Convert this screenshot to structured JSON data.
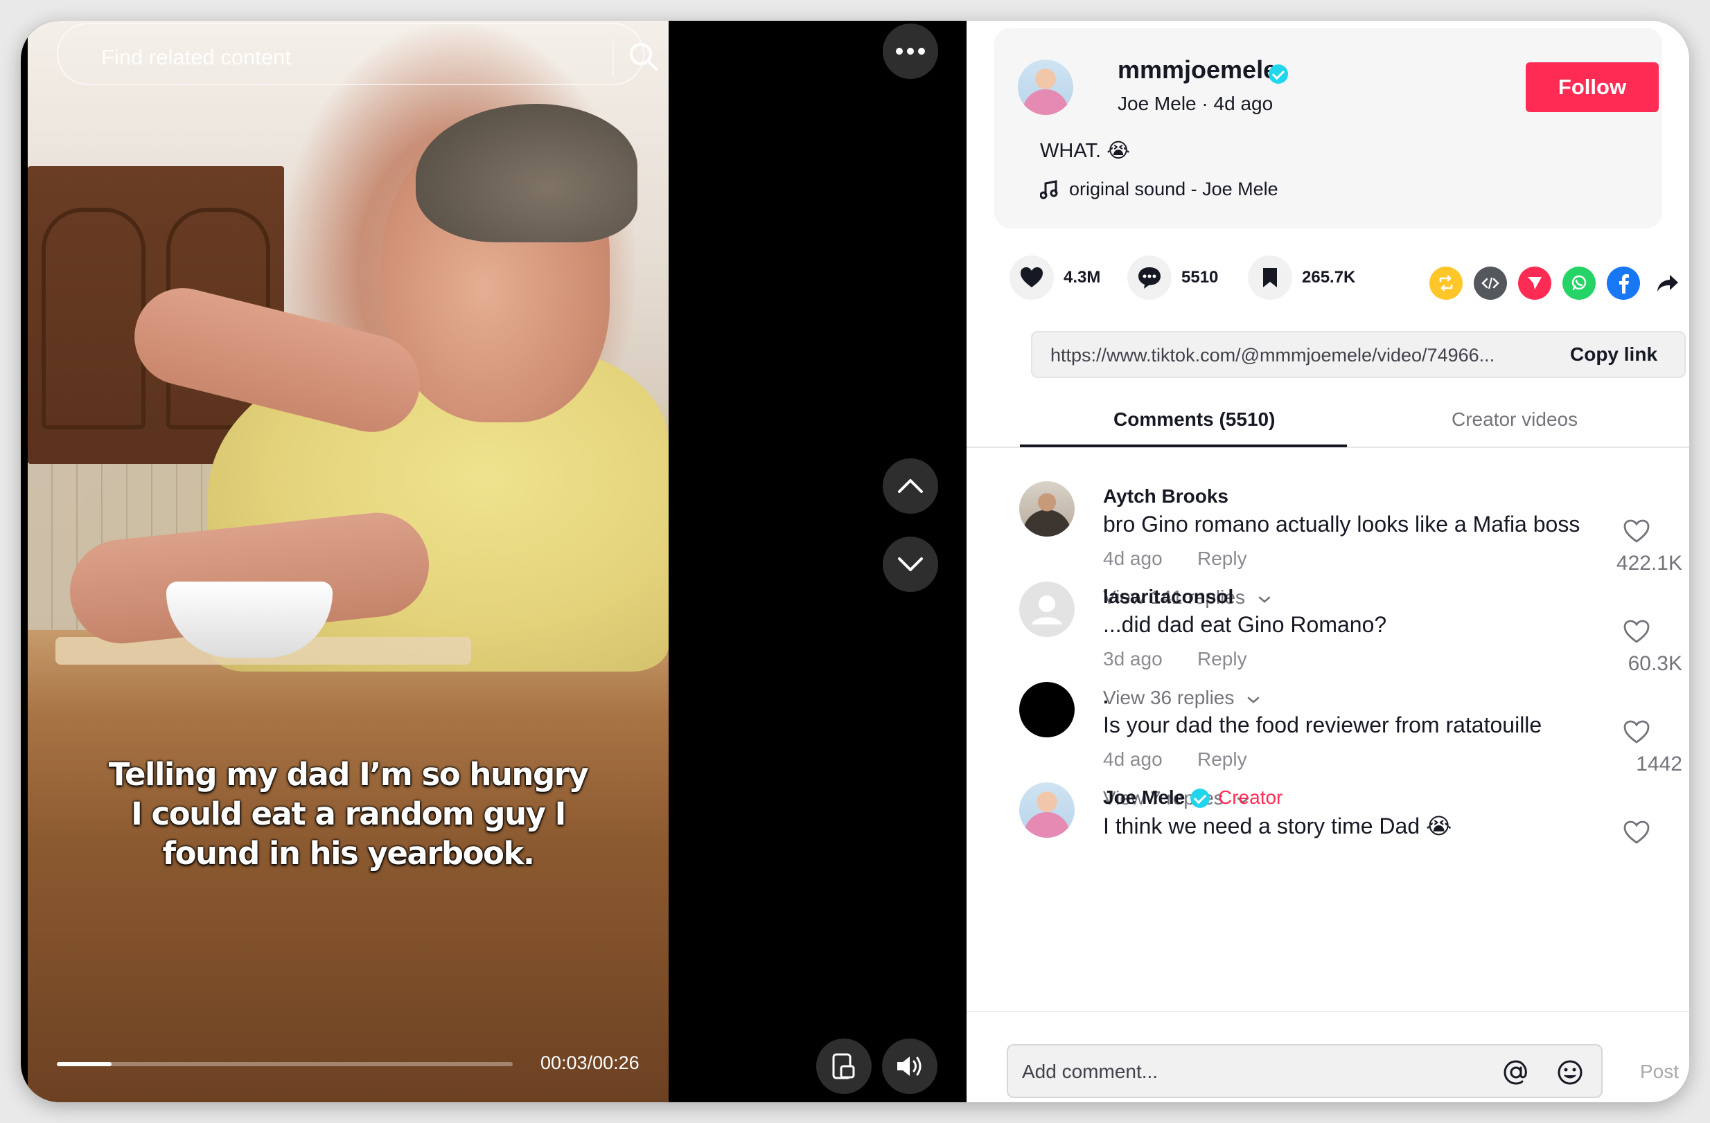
{
  "search": {
    "placeholder": "Find related content"
  },
  "video": {
    "caption_lines": [
      "Telling my dad I’m so hungry",
      "I could eat a random guy I",
      "found in his yearbook."
    ],
    "timecode": "00:03/00:26",
    "progress_fraction": 0.12
  },
  "author": {
    "username": "mmmjoemele",
    "display_name": "Joe Mele",
    "posted": "4d ago",
    "separator": " · ",
    "verified": true,
    "follow_label": "Follow",
    "description": "WHAT. 😭",
    "music": "original sound - Joe Mele"
  },
  "stats": {
    "likes": "4.3M",
    "comments": "5510",
    "saves": "265.7K"
  },
  "share_icons": [
    "repost-icon",
    "embed-icon",
    "send-icon",
    "whatsapp-icon",
    "facebook-icon",
    "share-arrow-icon"
  ],
  "link": {
    "url": "https://www.tiktok.com/@mmmjoemele/video/74966...",
    "copy_label": "Copy link"
  },
  "tabs": [
    {
      "label": "Comments (5510)",
      "active": true
    },
    {
      "label": "Creator videos",
      "active": false
    }
  ],
  "comments": [
    {
      "user": "Aytch Brooks",
      "text": "bro Gino romano actually looks like a Mafia boss",
      "time": "4d ago",
      "reply": "Reply",
      "replies": "View 141 replies",
      "likes": "422.1K",
      "avatar": "photo"
    },
    {
      "user": "lasaritaconsol",
      "text": "...did dad eat Gino Romano?",
      "time": "3d ago",
      "reply": "Reply",
      "replies": "View 36 replies",
      "likes": "60.3K",
      "avatar": "default"
    },
    {
      "user": ".",
      "text": "Is your dad the food reviewer from ratatouille",
      "time": "4d ago",
      "reply": "Reply",
      "replies": "View 7 replies",
      "likes": "1442",
      "avatar": "black"
    },
    {
      "user": "Joe Mele",
      "creator_tag": "Creator",
      "text": "I think we need a story time Dad 😭",
      "time": "",
      "reply": "",
      "replies": "",
      "likes": "",
      "avatar": "joe"
    }
  ],
  "composer": {
    "placeholder": "Add comment...",
    "post_label": "Post"
  },
  "colors": {
    "accent": "#fe2c55",
    "verified": "#20d5ec"
  }
}
